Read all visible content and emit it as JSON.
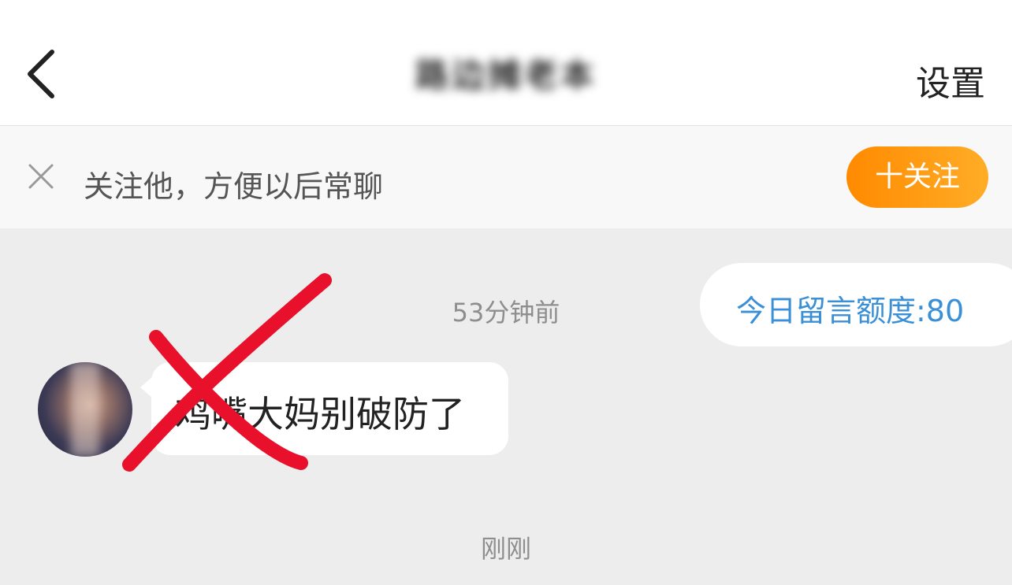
{
  "header": {
    "title": "路边摊老本",
    "settings_label": "设置"
  },
  "follow_bar": {
    "text": "关注他，方便以后常聊",
    "follow_button": "十关注"
  },
  "chat": {
    "quota_label": "今日留言额度:80",
    "timestamp_1": "53分钟前",
    "message_text": "鸡嘴大妈别破防了",
    "timestamp_2": "刚刚"
  },
  "colors": {
    "accent_orange": "#ff8a00",
    "quota_blue": "#3a8fd6",
    "annotation_red": "#e8102a"
  },
  "icons": {
    "back": "chevron-left-icon",
    "close": "close-icon"
  }
}
